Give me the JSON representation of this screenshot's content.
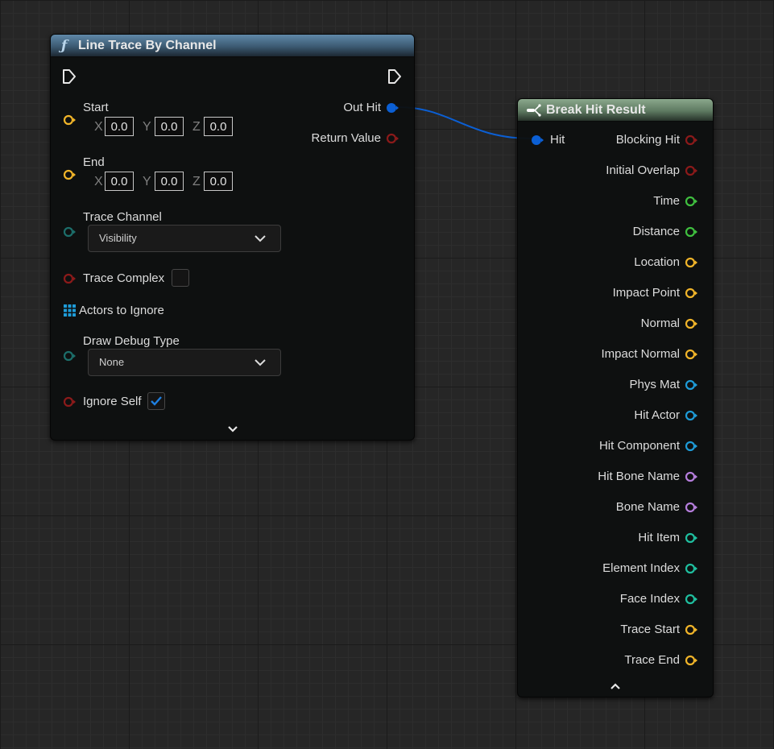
{
  "line_trace_node": {
    "title": "Line Trace By Channel",
    "header_icon": "function-icon",
    "start": {
      "label": "Start",
      "x_axis": "X",
      "y_axis": "Y",
      "z_axis": "Z",
      "x": "0.0",
      "y": "0.0",
      "z": "0.0"
    },
    "end": {
      "label": "End",
      "x_axis": "X",
      "y_axis": "Y",
      "z_axis": "Z",
      "x": "0.0",
      "y": "0.0",
      "z": "0.0"
    },
    "trace_channel": {
      "label": "Trace Channel",
      "value": "Visibility"
    },
    "trace_complex": {
      "label": "Trace Complex",
      "checked": false
    },
    "actors_to_ignore": {
      "label": "Actors to Ignore"
    },
    "draw_debug_type": {
      "label": "Draw Debug Type",
      "value": "None"
    },
    "ignore_self": {
      "label": "Ignore Self",
      "checked": true
    },
    "outputs": {
      "out_hit": "Out Hit",
      "return_value": "Return Value"
    }
  },
  "break_hit_node": {
    "title": "Break Hit Result",
    "header_icon": "break-struct-icon",
    "input_label": "Hit",
    "outputs": [
      {
        "label": "Blocking Hit",
        "color": "#8b1a1a"
      },
      {
        "label": "Initial Overlap",
        "color": "#8b1a1a"
      },
      {
        "label": "Time",
        "color": "#3fbf3f"
      },
      {
        "label": "Distance",
        "color": "#3fbf3f"
      },
      {
        "label": "Location",
        "color": "#f0b429"
      },
      {
        "label": "Impact Point",
        "color": "#f0b429"
      },
      {
        "label": "Normal",
        "color": "#f0b429"
      },
      {
        "label": "Impact Normal",
        "color": "#f0b429"
      },
      {
        "label": "Phys Mat",
        "color": "#1e9bd7"
      },
      {
        "label": "Hit Actor",
        "color": "#1e9bd7"
      },
      {
        "label": "Hit Component",
        "color": "#1e9bd7"
      },
      {
        "label": "Hit Bone Name",
        "color": "#b57edc"
      },
      {
        "label": "Bone Name",
        "color": "#b57edc"
      },
      {
        "label": "Hit Item",
        "color": "#1fbf9f"
      },
      {
        "label": "Element Index",
        "color": "#1fbf9f"
      },
      {
        "label": "Face Index",
        "color": "#1fbf9f"
      },
      {
        "label": "Trace Start",
        "color": "#f0b429"
      },
      {
        "label": "Trace End",
        "color": "#f0b429"
      }
    ]
  },
  "colors": {
    "vector": "#f0b429",
    "enum": "#1c6e6a",
    "bool": "#8b1a1a",
    "struct": "#0b5fd4",
    "wire": "#0b5fd4"
  }
}
